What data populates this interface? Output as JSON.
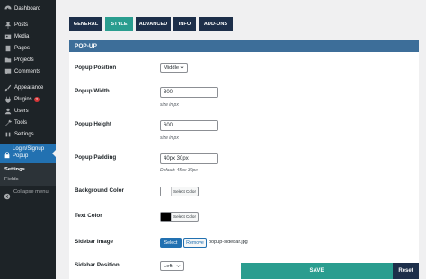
{
  "sidebar": {
    "items": [
      {
        "label": "Dashboard",
        "icon": "dashboard-icon"
      },
      {
        "label": "Posts",
        "icon": "pin-icon"
      },
      {
        "label": "Media",
        "icon": "media-icon"
      },
      {
        "label": "Pages",
        "icon": "page-icon"
      },
      {
        "label": "Projects",
        "icon": "folder-icon"
      },
      {
        "label": "Comments",
        "icon": "comment-icon"
      },
      {
        "label": "Appearance",
        "icon": "brush-icon"
      },
      {
        "label": "Plugins",
        "icon": "plugin-icon",
        "badge": "3"
      },
      {
        "label": "Users",
        "icon": "user-icon"
      },
      {
        "label": "Tools",
        "icon": "wrench-icon"
      },
      {
        "label": "Settings",
        "icon": "settings-icon"
      }
    ],
    "active": {
      "label_line1": "Login/Signup",
      "label_line2": "Popup",
      "icon": "lock-icon"
    },
    "submenu": [
      "Settings",
      "Fields"
    ],
    "collapse_label": "Collapse menu"
  },
  "tabs": [
    {
      "label": "GENERAL",
      "active": false
    },
    {
      "label": "STYLE",
      "active": true
    },
    {
      "label": "ADVANCED",
      "active": false
    },
    {
      "label": "INFO",
      "active": false
    },
    {
      "label": "ADD-ONS",
      "active": false
    }
  ],
  "section_title": "POP-UP",
  "fields": {
    "position": {
      "label": "Popup Position",
      "value": "Middle"
    },
    "width": {
      "label": "Popup Width",
      "value": "800",
      "hint": "size in px"
    },
    "height": {
      "label": "Popup Height",
      "value": "600",
      "hint": "size in px"
    },
    "padding": {
      "label": "Popup Padding",
      "value": "40px 30px",
      "hint": "Default: 45px 30px"
    },
    "bg_color": {
      "label": "Background Color",
      "button": "Select Color",
      "color": "#ffffff"
    },
    "text_color": {
      "label": "Text Color",
      "button": "Select Color",
      "color": "#000000"
    },
    "sidebar_image": {
      "label": "Sidebar Image",
      "select": "Select",
      "remove": "Remove",
      "filename": "popup-sidebar.jpg"
    },
    "sidebar_position": {
      "label": "Sidebar Position",
      "value": "Left"
    }
  },
  "actions": {
    "save": "SAVE",
    "reset": "Reset"
  },
  "colors": {
    "tab": "#1d2f4a",
    "tab_active": "#2a9d8f",
    "section_header": "#3d6e99",
    "wp_blue": "#2271b1"
  }
}
